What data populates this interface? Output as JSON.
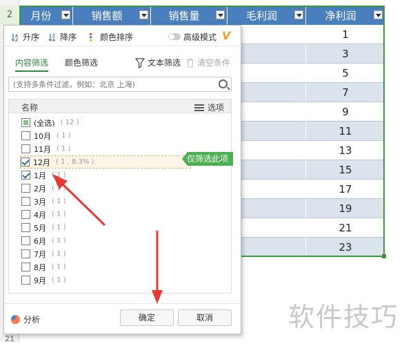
{
  "sheet": {
    "row_numbers": {
      "top": "2",
      "bottom": "21"
    },
    "headers": [
      "月份",
      "销售额",
      "销售量",
      "毛利润",
      "净利润"
    ],
    "net_profit_values": [
      "1",
      "3",
      "5",
      "7",
      "9",
      "11",
      "13",
      "15",
      "17",
      "19",
      "21",
      "23"
    ]
  },
  "toolbar": {
    "sort_asc": "升序",
    "sort_desc": "降序",
    "color_sort": "颜色排序",
    "advanced_mode": "高级模式",
    "logo": "V"
  },
  "tabs": {
    "content_filter": "内容筛选",
    "color_filter": "颜色筛选",
    "text_filter": "文本筛选",
    "clear": "清空条件"
  },
  "search": {
    "placeholder": "(支持多条件过滤，例如：北京 上海)"
  },
  "list": {
    "name_header": "名称",
    "options_label": "选项",
    "items": [
      {
        "label": "(全选)",
        "count": "( 12 )",
        "state": "partial"
      },
      {
        "label": "10月",
        "count": "( 1 )",
        "state": "unchecked"
      },
      {
        "label": "11月",
        "count": "( 1 )",
        "state": "unchecked"
      },
      {
        "label": "12月",
        "count": "( 1 , 8.3% )",
        "state": "checked"
      },
      {
        "label": "1月",
        "count": "( 1 )",
        "state": "checked"
      },
      {
        "label": "2月",
        "count": "( 1 )",
        "state": "unchecked"
      },
      {
        "label": "3月",
        "count": "( 1 )",
        "state": "unchecked"
      },
      {
        "label": "4月",
        "count": "( 1 )",
        "state": "unchecked"
      },
      {
        "label": "5月",
        "count": "( 1 )",
        "state": "unchecked"
      },
      {
        "label": "6月",
        "count": "( 1 )",
        "state": "unchecked"
      },
      {
        "label": "7月",
        "count": "( 1 )",
        "state": "unchecked"
      },
      {
        "label": "8月",
        "count": "( 1 )",
        "state": "unchecked"
      },
      {
        "label": "9月",
        "count": "( 1 )",
        "state": "unchecked"
      }
    ],
    "only_filter_label": "仅筛选此项"
  },
  "footer": {
    "analysis": "分析",
    "ok": "确定",
    "cancel": "取消"
  },
  "watermark": "软件技巧",
  "colors": {
    "header_blue": "#4a7fbd",
    "accent_green": "#2d8a3e",
    "arrow_red": "#e53935"
  }
}
